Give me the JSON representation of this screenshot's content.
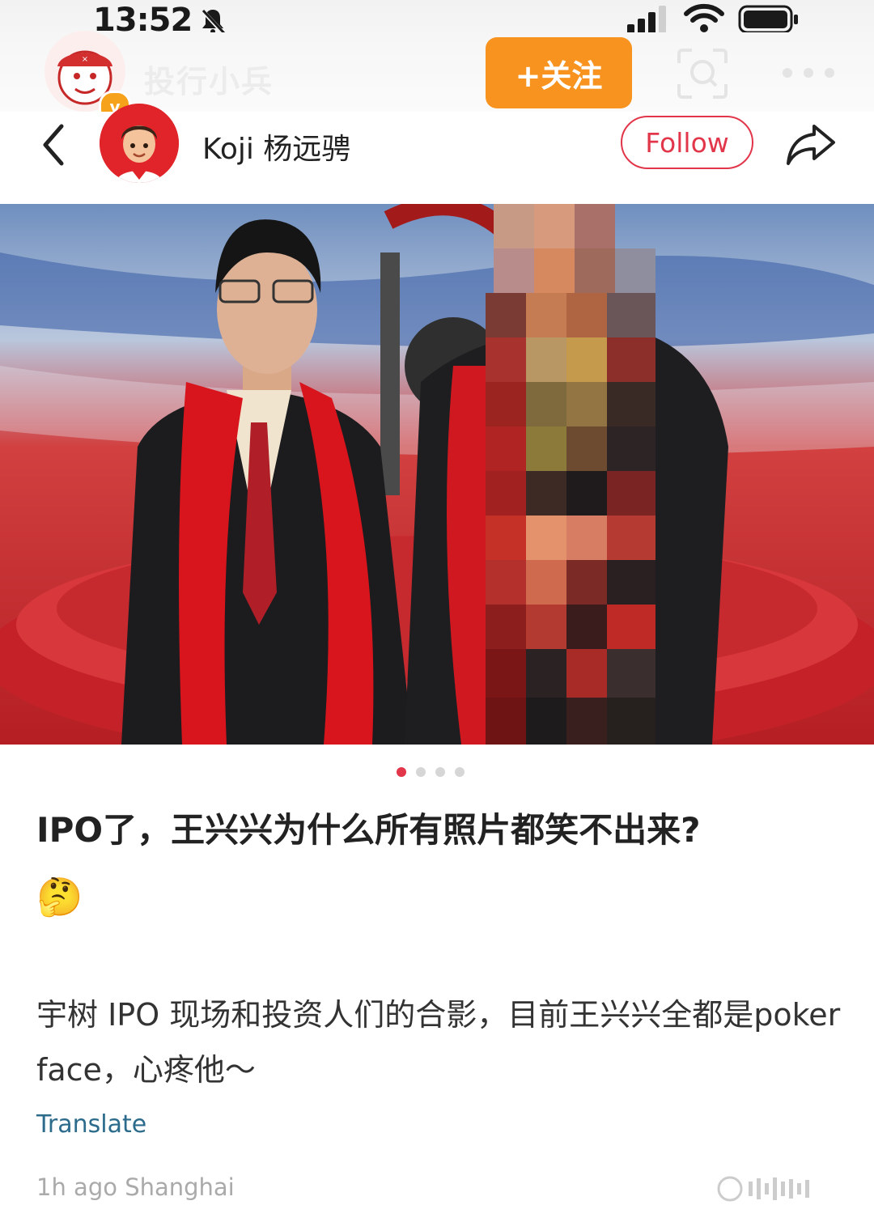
{
  "status_bar": {
    "time": "13:52"
  },
  "watermark": {
    "account_name": "投行小兵",
    "follow_label": "+关注"
  },
  "nav": {
    "username": "Koji 杨远骋",
    "follow_label": "Follow"
  },
  "carousel": {
    "total": 4,
    "active_index": 0
  },
  "post": {
    "title": "IPO了，王兴兴为什么所有照片都笑不出来?",
    "title_emoji": "🤔",
    "body": "宇树 IPO 现场和投资人们的合影，目前王兴兴全都是poker face，心疼他～",
    "translate_label": "Translate",
    "meta": "1h ago Shanghai"
  },
  "colors": {
    "accent_red": "#e2364a",
    "orange": "#f7931e",
    "link_blue": "#2c6b8c"
  }
}
